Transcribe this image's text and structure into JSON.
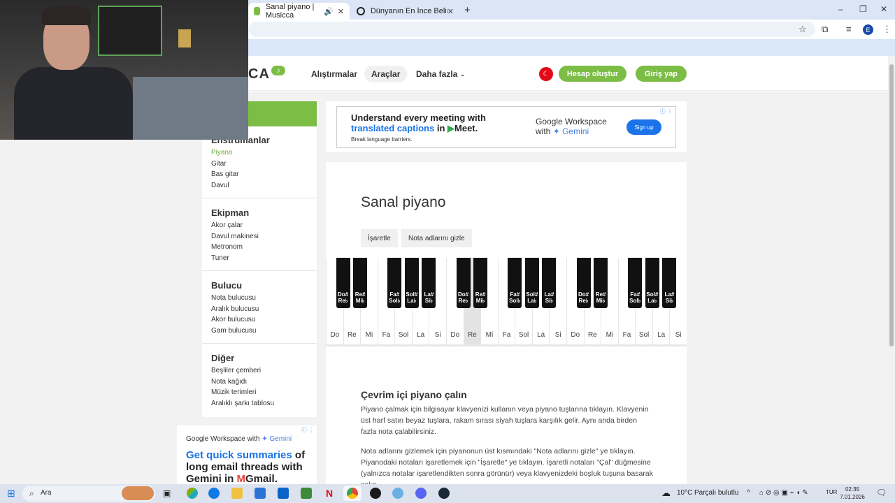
{
  "browser": {
    "tabs": [
      {
        "title": "Sanal piyano | Musicca",
        "active": true
      },
      {
        "title": "Dünyanın En İnce Beline Sahip",
        "active": false
      }
    ],
    "new_tab": "+",
    "window_controls": [
      "–",
      "❐",
      "✕"
    ],
    "profile_initial": "E"
  },
  "site": {
    "logo_text": "CA",
    "nav": [
      "Alıştırmalar",
      "Araçlar",
      "Daha fazla"
    ],
    "nav_selected": "Araçlar",
    "create_account": "Hesap oluştur",
    "login": "Giriş yap"
  },
  "sidebar": {
    "groups": [
      {
        "title": "Enstrumanlar",
        "items": [
          "Piyano",
          "Gitar",
          "Bas gitar",
          "Davul"
        ],
        "active": "Piyano"
      },
      {
        "title": "Ekipman",
        "items": [
          "Akor çalar",
          "Davul makinesi",
          "Metronom",
          "Tuner"
        ]
      },
      {
        "title": "Bulucu",
        "items": [
          "Nota bulucusu",
          "Aralık bulucusu",
          "Akor bulucusu",
          "Gam bulucusu"
        ]
      },
      {
        "title": "Diğer",
        "items": [
          "Beşliler çemberi",
          "Nota kağıdı",
          "Müzik terimleri",
          "Aralıklı şarkı tablosu"
        ]
      }
    ]
  },
  "ad_top": {
    "headline1": "Understand every meeting with",
    "headline2a": "translated captions",
    "headline2b": "in",
    "headline2c": "Meet.",
    "sub": "Break language barriers.",
    "brand1": "Google Workspace",
    "brand2": "with",
    "brand3": "Gemini",
    "cta": "Sign up"
  },
  "ad_left": {
    "brand": "Google Workspace with",
    "brand_gemini": "Gemini",
    "line1": "Get quick summaries",
    "line1b": "of",
    "line2": "long email threads with",
    "line3": "Gemini in",
    "line3b": "Gmail."
  },
  "main": {
    "title": "Sanal piyano",
    "btn_mark": "İşaretle",
    "btn_hide": "Nota adlarını gizle",
    "section_title": "Çevrim içi piyano çalın",
    "para1": "Piyano çalmak için bilgisayar klavyenizi kullanın veya piyano tuşlarına tıklayın. Klavyenin üst harf satırı beyaz tuşlara, rakam sırası siyah tuşlara karşılık gelir. Aynı anda birden fazla nota çalabilirsiniz.",
    "para2": "Nota adlarını gizlemek için piyanonun üst kısmındaki \"Nota adlarını gizle\" ye tıklayın. Piyanodaki notaları işaretlemek için \"İşaretle\" ye tıklayın. İşaretli notaları \"Çal\" düğmesine (yalnızca notalar işaretlendikten sonra görünür) veya klavyenizdeki boşluk tuşuna basarak çalın."
  },
  "piano": {
    "white_keys": [
      "Do",
      "Re",
      "Mi",
      "Fa",
      "Sol",
      "La",
      "Si",
      "Do",
      "Re",
      "Mi",
      "Fa",
      "Sol",
      "La",
      "Si",
      "Do",
      "Re",
      "Mi",
      "Fa",
      "Sol",
      "La",
      "Si"
    ],
    "pressed_white_index": 8,
    "black_keys": [
      {
        "top": "Do#",
        "bottom": "Re♭"
      },
      {
        "top": "Re#",
        "bottom": "Mi♭"
      },
      {
        "top": "Fa#",
        "bottom": "Sol♭"
      },
      {
        "top": "Sol#",
        "bottom": "La♭"
      },
      {
        "top": "La#",
        "bottom": "Si♭"
      },
      {
        "top": "Do#",
        "bottom": "Re♭"
      },
      {
        "top": "Re#",
        "bottom": "Mi♭"
      },
      {
        "top": "Fa#",
        "bottom": "Sol♭"
      },
      {
        "top": "Sol#",
        "bottom": "La♭"
      },
      {
        "top": "La#",
        "bottom": "Si♭"
      },
      {
        "top": "Do#",
        "bottom": "Re♭"
      },
      {
        "top": "Re#",
        "bottom": "Mi♭"
      },
      {
        "top": "Fa#",
        "bottom": "Sol♭"
      },
      {
        "top": "Sol#",
        "bottom": "La♭"
      },
      {
        "top": "La#",
        "bottom": "Si♭"
      }
    ]
  },
  "taskbar": {
    "search_label": "Ara",
    "weather": "10°C",
    "weather_desc": "Parçalı bulutlu",
    "lang": "TUR",
    "time": "02:35",
    "date": "7.01.2026"
  },
  "colors": {
    "accent_green": "#7cbd45",
    "tab_bar": "#dbe5f6"
  }
}
